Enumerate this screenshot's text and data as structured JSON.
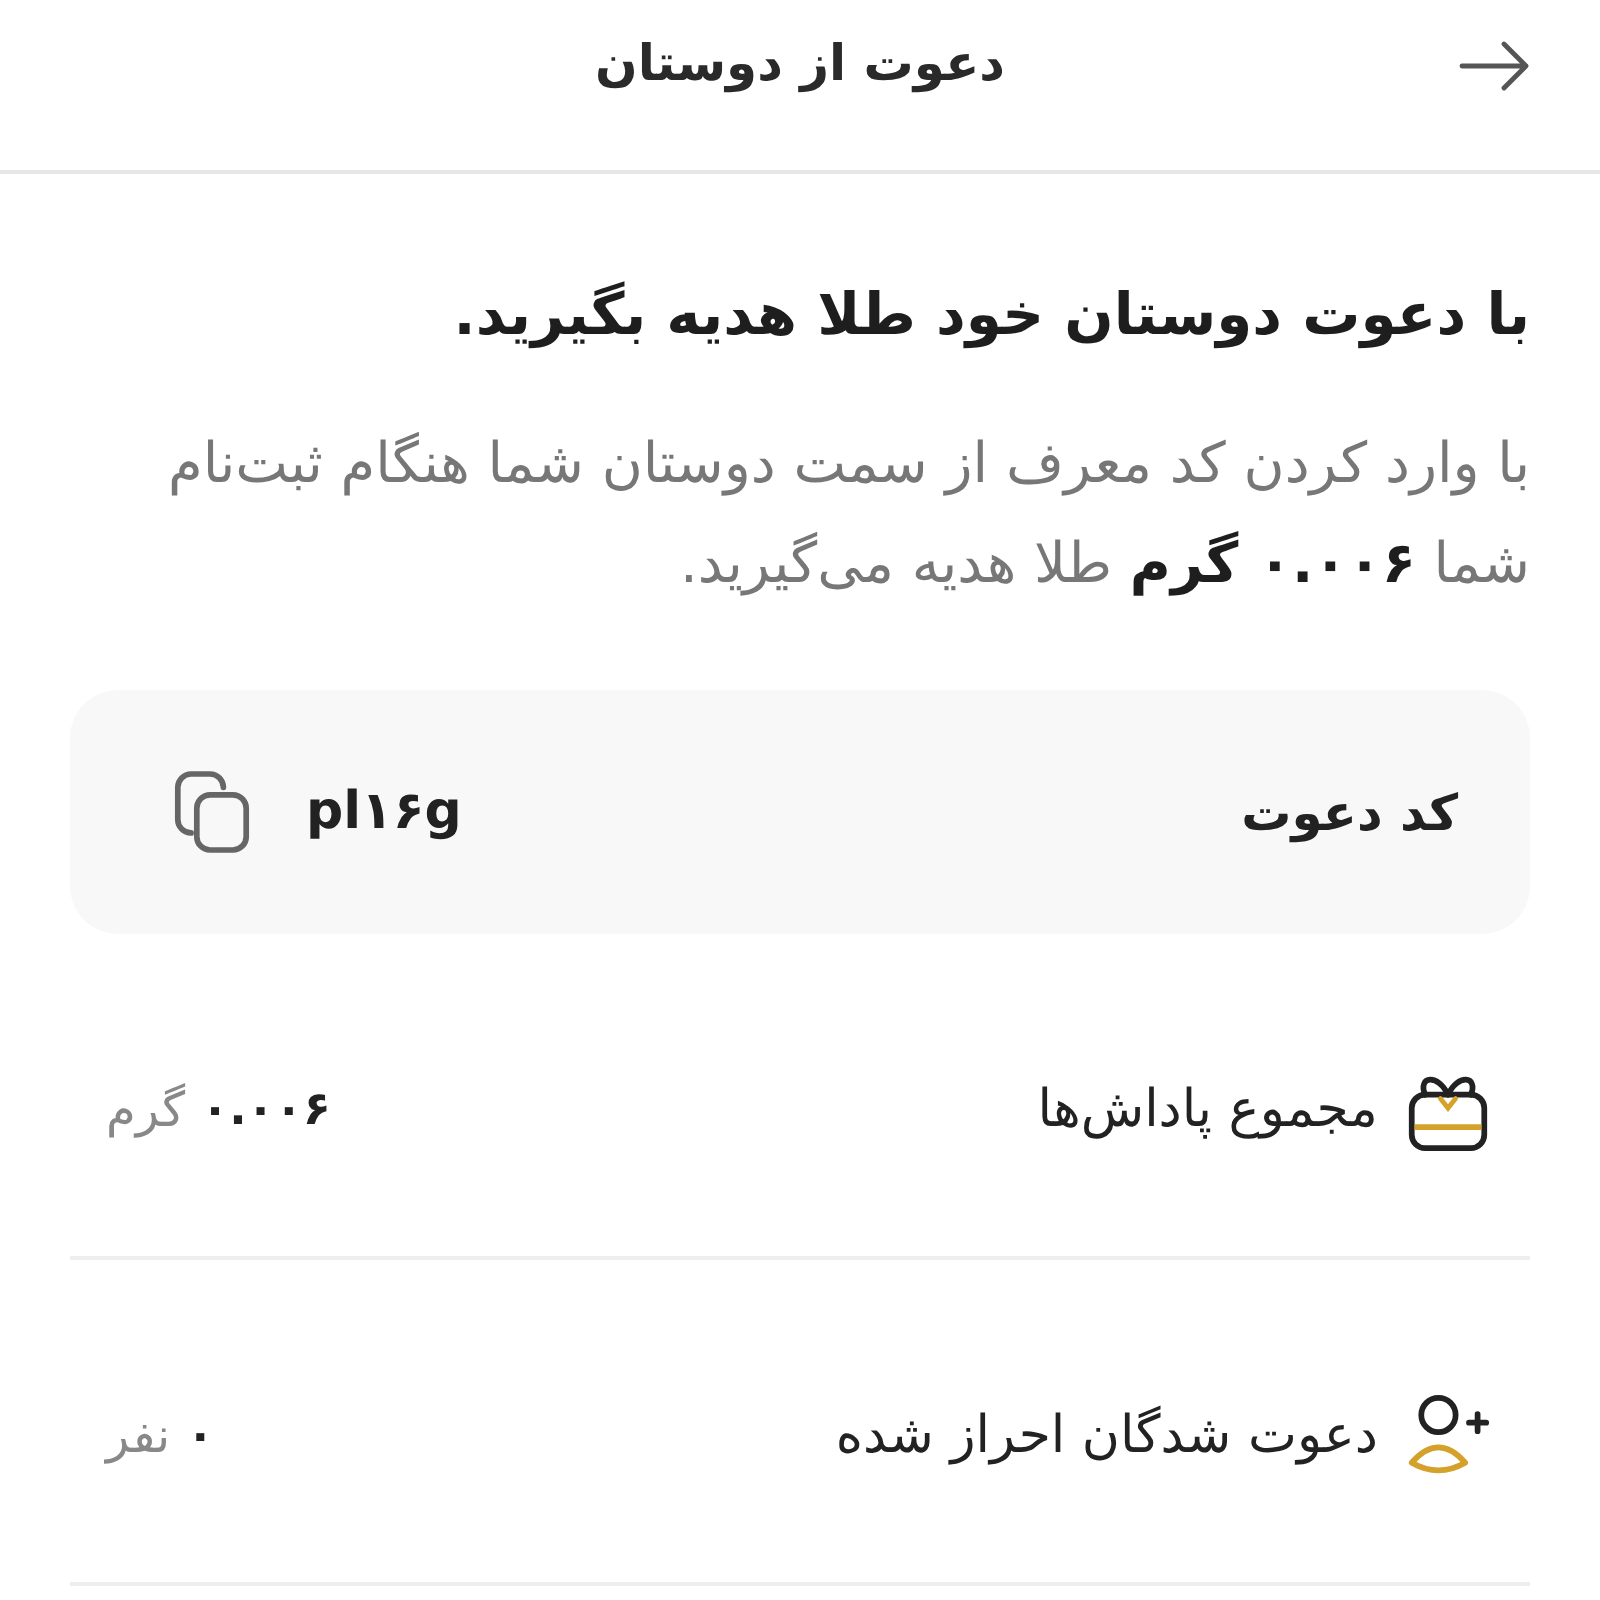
{
  "header": {
    "title": "دعوت از دوستان"
  },
  "intro": {
    "heading": "با دعوت دوستان خود طلا هدیه بگیرید.",
    "text": "با وارد کردن کد معرف از سمت دوستان شما هنگام ثبت‌نام شما **۰.۰۰۶ گرم** طلا هدیه می‌گیرید."
  },
  "invite_code": {
    "label": "کد دعوت",
    "code": "pl۱۶g"
  },
  "stats": [
    {
      "kind": "gift",
      "label": "مجموع پاداش‌ها",
      "value": "۰.۰۰۶",
      "unit": "گرم"
    },
    {
      "kind": "user",
      "label": "دعوت شدگان احراز شده",
      "value": "۰",
      "unit": "نفر"
    }
  ]
}
